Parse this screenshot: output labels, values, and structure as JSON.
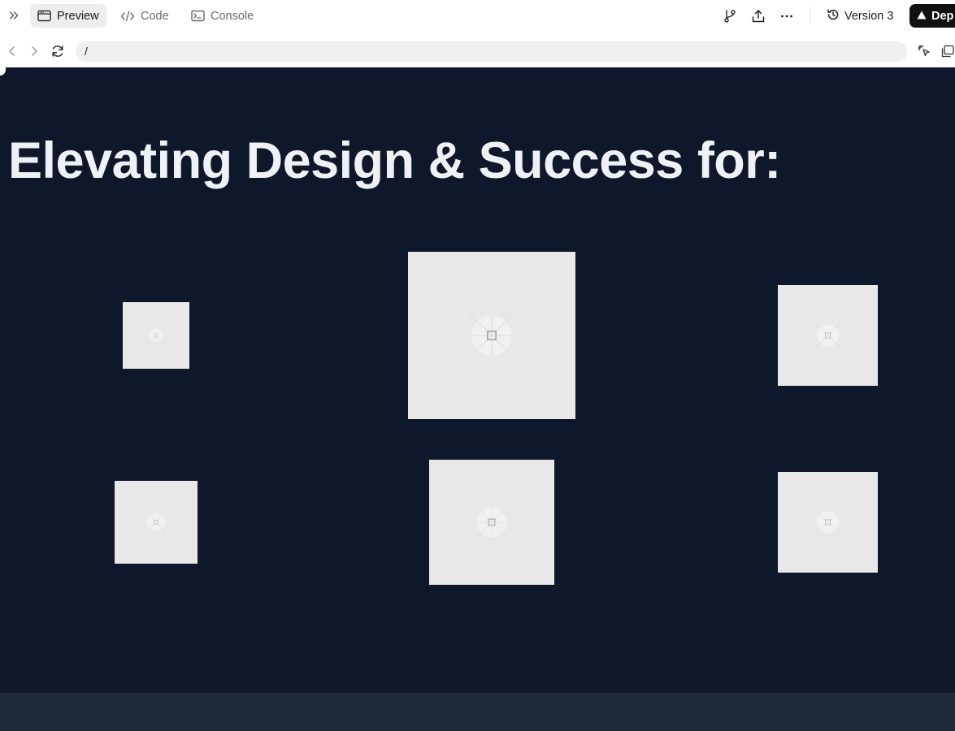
{
  "toolbar": {
    "collapse_icon": "double-chevron-right-icon",
    "tabs": [
      {
        "label": "Preview",
        "icon": "browser-window-icon",
        "active": true
      },
      {
        "label": "Code",
        "icon": "code-brackets-icon",
        "active": false
      },
      {
        "label": "Console",
        "icon": "terminal-icon",
        "active": false
      }
    ],
    "actions": [
      "branch-icon",
      "share-upload-icon",
      "more-dots-icon"
    ],
    "version_label": "Version 3",
    "version_icon": "history-icon",
    "deploy_label": "Dep",
    "deploy_icon": "triangle-icon"
  },
  "address_bar": {
    "url": "/",
    "icons": [
      "back-arrow-icon",
      "forward-arrow-icon",
      "reload-icon",
      "element-select-icon",
      "open-window-icon"
    ]
  },
  "preview": {
    "background": "#0f172a",
    "footer_background": "#1e293b",
    "headline": "Elevating Design & Success for:",
    "logo_placeholders": [
      {
        "id": "logo-1",
        "icon": "image-placeholder-icon"
      },
      {
        "id": "logo-2",
        "icon": "image-placeholder-icon"
      },
      {
        "id": "logo-3",
        "icon": "image-placeholder-icon"
      },
      {
        "id": "logo-4",
        "icon": "image-placeholder-icon"
      },
      {
        "id": "logo-5",
        "icon": "image-placeholder-icon"
      },
      {
        "id": "logo-6",
        "icon": "image-placeholder-icon"
      }
    ]
  }
}
